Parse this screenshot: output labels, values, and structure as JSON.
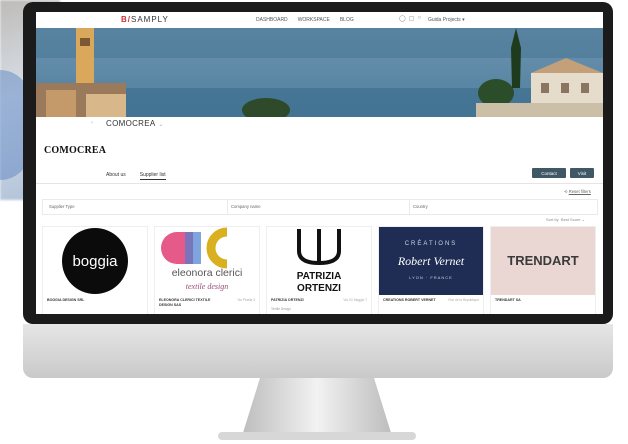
{
  "header": {
    "logo_brand": "B/",
    "logo_text": "SAMPLY",
    "nav": [
      "DASHBOARD",
      "WORKSPACE",
      "BLOG"
    ],
    "user": "Guida Projects"
  },
  "supplier": {
    "name": "COMOCREA",
    "logo_text": "COMOCREA"
  },
  "tabs": [
    {
      "label": "About us",
      "active": false
    },
    {
      "label": "Supplier list",
      "active": true
    }
  ],
  "buttons": {
    "contact": "Contact",
    "visit": "Visit"
  },
  "filters": {
    "reset": "Reset filters",
    "supplier_type": "Supplier Type",
    "company_name": "Company name",
    "country": "Country",
    "sort_label": "Sort by",
    "sort_value": "Best Score"
  },
  "cards": [
    {
      "name": "BOGGIA DESIGN SRL",
      "country": "",
      "logo": "boggia"
    },
    {
      "name": "ELEONORA CLERICI TEXTILE DESIGN SAS",
      "country": "Via Pinella 3",
      "logo_line1": "eleonora clerici",
      "logo_line2": "textile design"
    },
    {
      "name": "PATRIZIA ORTENZI",
      "country": "Via XX Maggio 7",
      "logo_line1": "PATRIZIA",
      "logo_line2": "ORTENZI",
      "sub": "Textile Design"
    },
    {
      "name": "CREATIONS ROBERT VERNET",
      "country": "Rue de la Republique",
      "logo_line1": "CRÉATIONS",
      "logo_line2": "Robert Vernet",
      "logo_line3": "LYON · FRANCE"
    },
    {
      "name": "TRENDART SA",
      "country": "",
      "logo": "TRENDART"
    }
  ],
  "colors": {
    "primary_button": "#3f5866",
    "bezel": "#1b1b1b",
    "vernet_bg": "#1f2d55",
    "trendart_bg": "#ead7d4"
  }
}
